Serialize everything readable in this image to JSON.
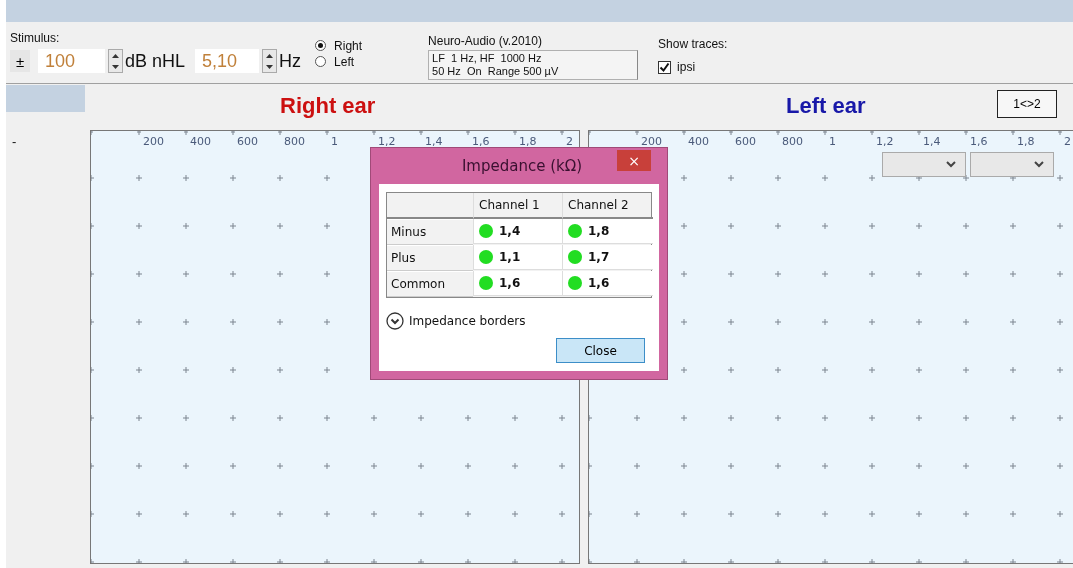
{
  "stimulus": {
    "label": "Stimulus:",
    "sign_button": "±",
    "level": {
      "value": "100",
      "unit": "dB nHL"
    },
    "rate": {
      "value": "5,10",
      "unit": "Hz"
    }
  },
  "ear_options": [
    {
      "label": "Right",
      "selected": true
    },
    {
      "label": "Left",
      "selected": false
    }
  ],
  "device": {
    "title": "Neuro-Audio (v.2010)",
    "lines": [
      "LF  1 Hz, HF  1000 Hz",
      "50 Hz  On  Range 500 µV"
    ]
  },
  "traces": {
    "label": "Show traces:",
    "options": [
      {
        "label": "ipsi",
        "checked": true
      }
    ]
  },
  "side_marker": "-",
  "swap_button": "1<>2",
  "plots": [
    {
      "title": "Right ear",
      "color": "#cc1010",
      "x_labels": [
        "200",
        "400",
        "600",
        "800",
        "1",
        "1,2",
        "1,4",
        "1,6",
        "1,8",
        "2"
      ]
    },
    {
      "title": "Left ear",
      "color": "#1818a8",
      "x_labels": [
        "200",
        "400",
        "600",
        "800",
        "1",
        "1,2",
        "1,4",
        "1,6",
        "1,8",
        "2"
      ],
      "dropdowns": [
        {
          "expanded": false
        },
        {
          "expanded": false
        }
      ]
    }
  ],
  "dialog": {
    "title": "Impedance (kΩ)",
    "close": "×",
    "columns": [
      "Channel 1",
      "Channel 2"
    ],
    "rows": [
      {
        "label": "Minus",
        "cells": [
          {
            "value": "1,4",
            "color": "#22dd22"
          },
          {
            "value": "1,8",
            "color": "#22dd22"
          }
        ]
      },
      {
        "label": "Plus",
        "cells": [
          {
            "value": "1,1",
            "color": "#22dd22"
          },
          {
            "value": "1,7",
            "color": "#22dd22"
          }
        ]
      },
      {
        "label": "Common",
        "cells": [
          {
            "value": "1,6",
            "color": "#22dd22"
          },
          {
            "value": "1,6",
            "color": "#22dd22"
          }
        ]
      }
    ],
    "expander": {
      "label": "Impedance borders",
      "expanded": false
    },
    "button": "Close"
  }
}
